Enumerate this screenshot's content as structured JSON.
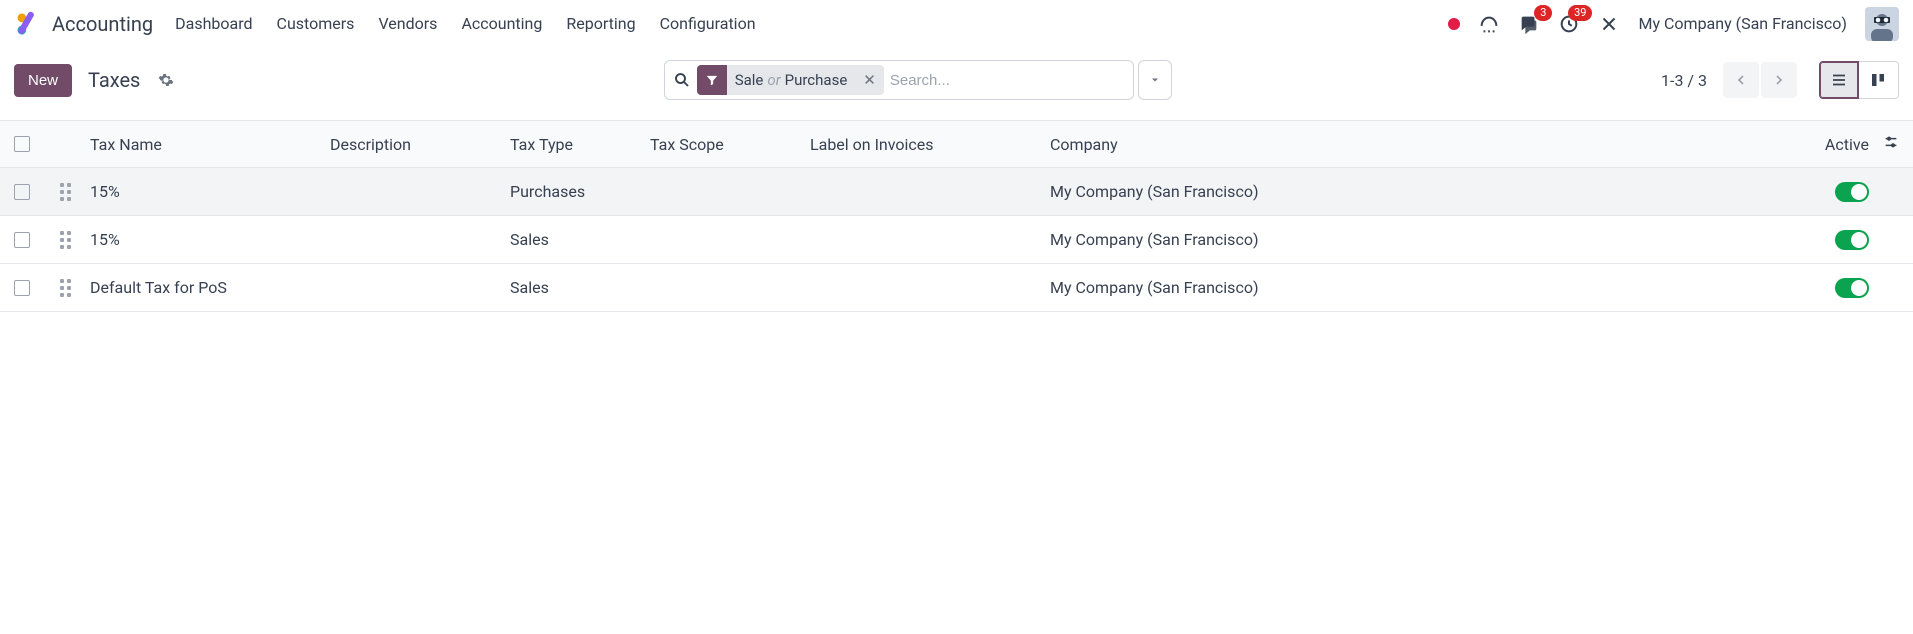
{
  "app": {
    "title": "Accounting"
  },
  "nav": {
    "items": [
      "Dashboard",
      "Customers",
      "Vendors",
      "Accounting",
      "Reporting",
      "Configuration"
    ]
  },
  "topbar": {
    "messages_badge": "3",
    "activities_badge": "39",
    "company": "My Company (San Francisco)"
  },
  "controls": {
    "new_label": "New",
    "breadcrumb": "Taxes",
    "filter": {
      "a": "Sale",
      "or": "or",
      "b": "Purchase"
    },
    "search_placeholder": "Search...",
    "pager": "1-3 / 3"
  },
  "table": {
    "headers": {
      "name": "Tax Name",
      "description": "Description",
      "type": "Tax Type",
      "scope": "Tax Scope",
      "label": "Label on Invoices",
      "company": "Company",
      "active": "Active"
    },
    "rows": [
      {
        "name": "15%",
        "description": "",
        "type": "Purchases",
        "scope": "",
        "label": "",
        "company": "My Company (San Francisco)",
        "active": true
      },
      {
        "name": "15%",
        "description": "",
        "type": "Sales",
        "scope": "",
        "label": "",
        "company": "My Company (San Francisco)",
        "active": true
      },
      {
        "name": "Default Tax for PoS",
        "description": "",
        "type": "Sales",
        "scope": "",
        "label": "",
        "company": "My Company (San Francisco)",
        "active": true
      }
    ]
  }
}
